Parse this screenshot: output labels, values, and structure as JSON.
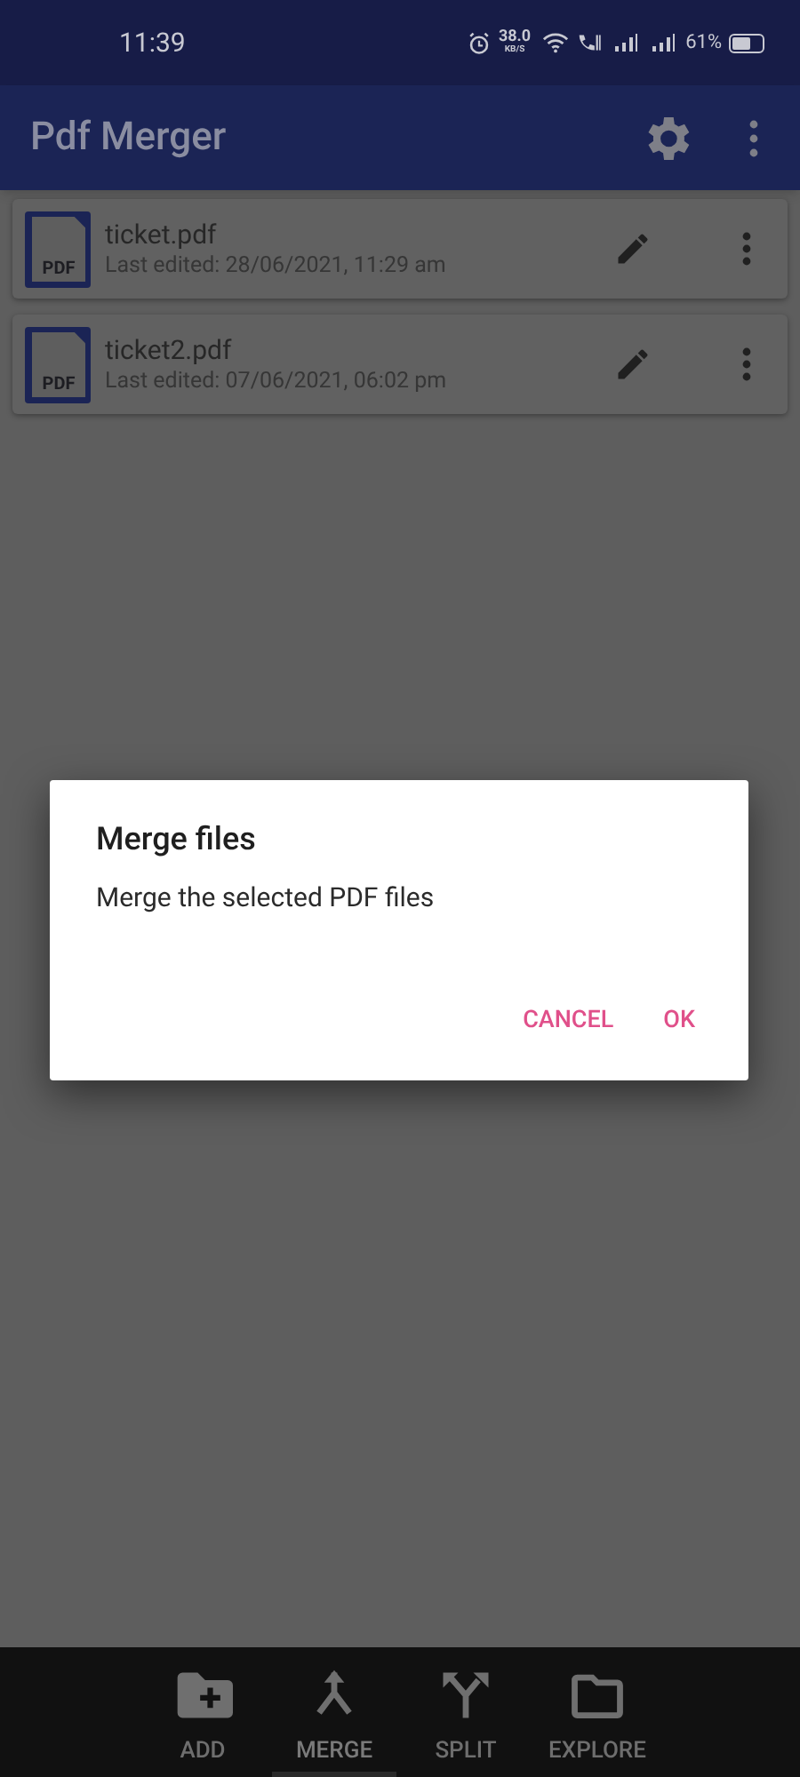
{
  "status_bar": {
    "time": "11:39",
    "speed": "38.0",
    "speed_unit": "KB/S",
    "battery": "61%"
  },
  "app_bar": {
    "title": "Pdf Merger"
  },
  "files": [
    {
      "badge": "PDF",
      "name": "ticket.pdf",
      "edited": "Last edited: 28/06/2021, 11:29 am"
    },
    {
      "badge": "PDF",
      "name": "ticket2.pdf",
      "edited": "Last edited: 07/06/2021, 06:02 pm"
    }
  ],
  "dialog": {
    "title": "Merge files",
    "message": "Merge the selected PDF files",
    "buttons": [
      "CANCEL",
      "OK"
    ]
  },
  "bottom_nav": [
    {
      "kind": "add",
      "label": "ADD",
      "selected": false
    },
    {
      "kind": "merge",
      "label": "MERGE",
      "selected": true
    },
    {
      "kind": "split",
      "label": "SPLIT",
      "selected": false
    },
    {
      "kind": "explore",
      "label": "EXPLORE",
      "selected": false
    }
  ]
}
